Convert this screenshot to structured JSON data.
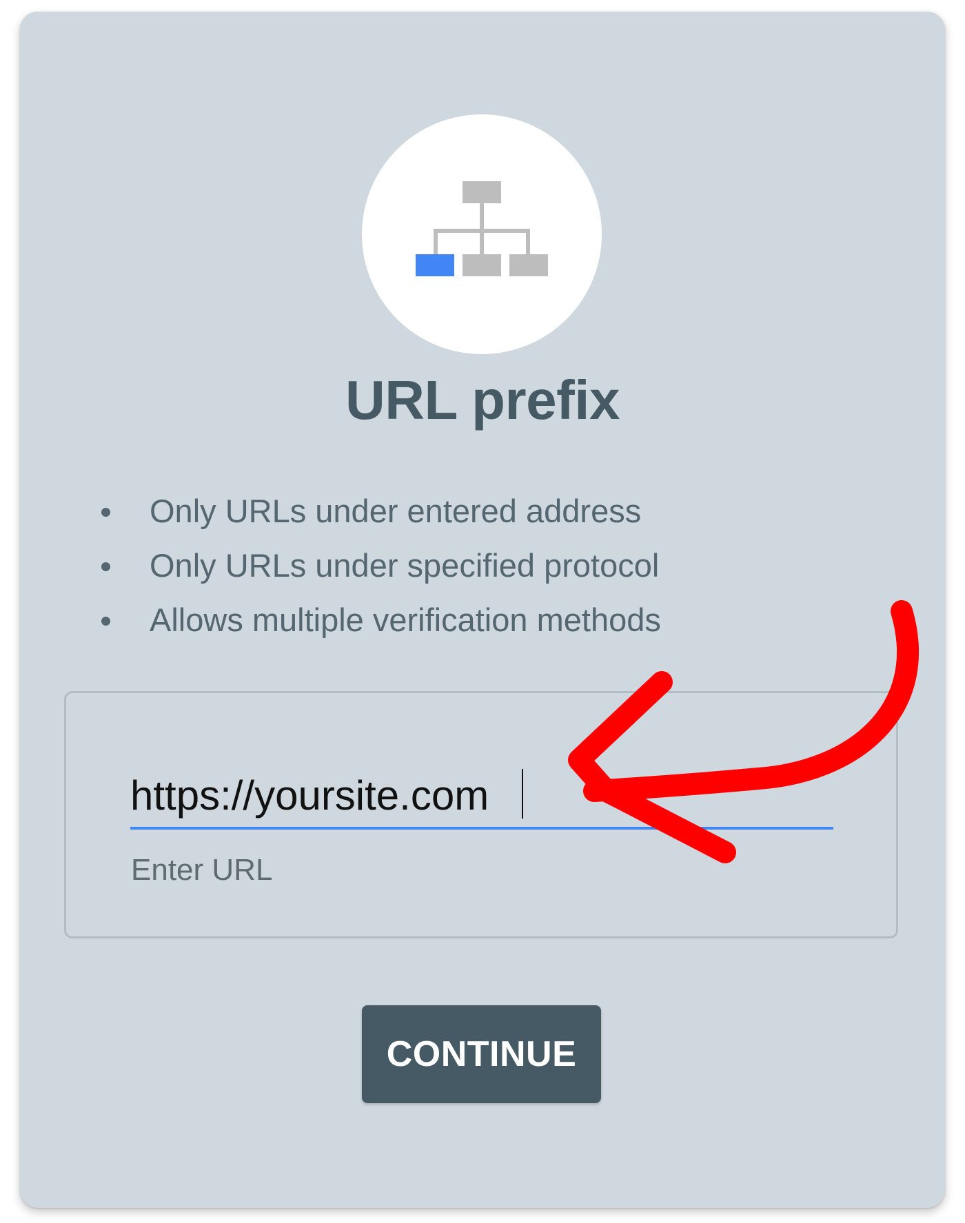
{
  "card": {
    "title": "URL prefix",
    "icon": "sitemap-icon",
    "bullets": [
      "Only URLs under entered address",
      "Only URLs under specified protocol",
      "Allows multiple verification methods"
    ]
  },
  "url_field": {
    "value": "https://yoursite.com",
    "helper_text": "Enter URL"
  },
  "continue_button": {
    "label": "CONTINUE"
  },
  "annotation": {
    "icon": "red-arrow-icon"
  },
  "colors": {
    "card_background": "#cfd8de",
    "title": "#455a64",
    "accent_blue": "#4285f4",
    "button": "#455a64",
    "arrow_red": "#ff0000"
  }
}
